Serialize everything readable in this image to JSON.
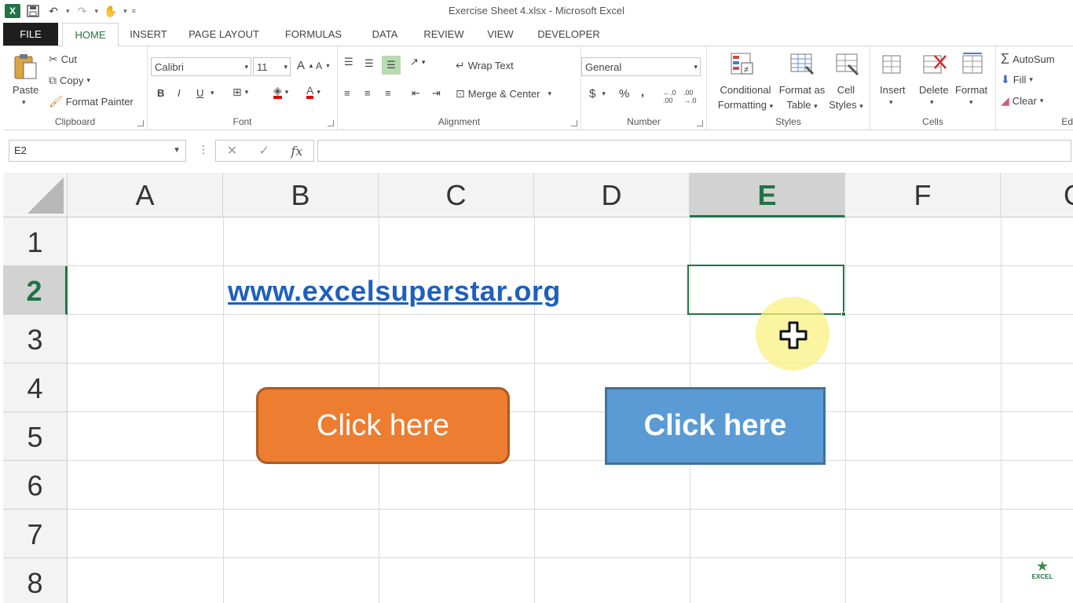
{
  "app": {
    "window_title": "Exercise Sheet 4.xlsx - Microsoft Excel",
    "logo_letter": "X"
  },
  "tabs": [
    {
      "label": "FILE"
    },
    {
      "label": "HOME"
    },
    {
      "label": "INSERT"
    },
    {
      "label": "PAGE LAYOUT"
    },
    {
      "label": "FORMULAS"
    },
    {
      "label": "DATA"
    },
    {
      "label": "REVIEW"
    },
    {
      "label": "VIEW"
    },
    {
      "label": "DEVELOPER"
    }
  ],
  "ribbon": {
    "clipboard": {
      "label": "Clipboard",
      "paste": "Paste",
      "cut": "Cut",
      "copy": "Copy",
      "format_painter": "Format Painter"
    },
    "font": {
      "label": "Font",
      "font_name": "Calibri",
      "font_size": "11",
      "bold": "B",
      "italic": "I",
      "underline": "U"
    },
    "alignment": {
      "label": "Alignment",
      "wrap_text": "Wrap Text",
      "merge_center": "Merge & Center"
    },
    "number": {
      "label": "Number",
      "format": "General",
      "currency": "$",
      "percent": "%",
      "comma": ","
    },
    "styles": {
      "label": "Styles",
      "conditional_1": "Conditional",
      "conditional_2": "Formatting",
      "format_table_1": "Format as",
      "format_table_2": "Table",
      "cell_styles_1": "Cell",
      "cell_styles_2": "Styles"
    },
    "cells": {
      "label": "Cells",
      "insert": "Insert",
      "delete": "Delete",
      "format": "Format"
    },
    "editing": {
      "label": "Ed",
      "autosum": "AutoSum",
      "fill": "Fill",
      "clear": "Clear"
    }
  },
  "formula_bar": {
    "name_box": "E2",
    "fx": "fx",
    "cancel": "✕",
    "enter": "✓",
    "value": ""
  },
  "grid": {
    "columns": [
      "A",
      "B",
      "C",
      "D",
      "E",
      "F",
      "G"
    ],
    "rows": [
      "1",
      "2",
      "3",
      "4",
      "5",
      "6",
      "7",
      "8"
    ],
    "selected_column": "E",
    "selected_row": "2",
    "link_text": "www.excelsuperstar.org"
  },
  "shapes": {
    "orange_button": "Click here",
    "blue_button": "Click here"
  },
  "watermark": {
    "text": "EXCEL"
  },
  "colors": {
    "excel_green": "#217346",
    "orange": "#ed7d31",
    "blue": "#5b9bd5",
    "link": "#1f5fbf"
  }
}
